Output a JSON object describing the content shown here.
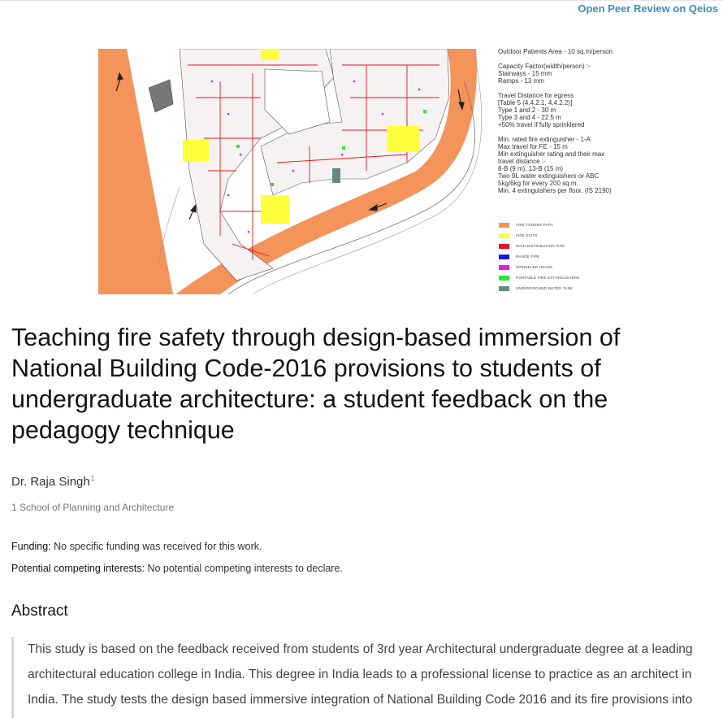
{
  "header": {
    "review_link": "Open Peer Review on Qeios"
  },
  "figure": {
    "notes": [
      {
        "lines": [
          "Outdoor Patients Area - 10 sq.m/person"
        ]
      },
      {
        "lines": [
          "Capacity Factor(width/person) :-",
          "Stairways - 15 mm",
          "Ramps - 13 mm"
        ]
      },
      {
        "lines": [
          "Travel Distance for egress",
          "[Table 5 (4.4.2.1, 4.4.2.2)]",
          "Type 1 and 2 - 30 m",
          "Type 3 and 4 - 22.5 m",
          "+50% travel if fully sprinklered"
        ]
      },
      {
        "lines": [
          "Min. rated fire extinguisher - 1-A",
          "Max travel for FE - 15 m",
          "Min extinguisher rating and their max",
          "travel distance :-",
          "8-B (9 m), 13-B (15 m)",
          "Two 9L water extinguishers or ABC",
          "5kg/6kg for every 200 sq.m.",
          "Min. 4 extinguishers per floor. (IS 2190)"
        ]
      }
    ],
    "legend": [
      {
        "label": "FIRE TENDER PATH",
        "color": "#f4935a"
      },
      {
        "label": "FIRE EXITS",
        "color": "#ffff3c"
      },
      {
        "label": "MAIN DISTRIBUTION PIPE",
        "color": "#e8141c"
      },
      {
        "label": "RANGE PIPE",
        "color": "#1a14e0"
      },
      {
        "label": "SPRINKLER HEADS",
        "color": "#f01ae0"
      },
      {
        "label": "PORTABLE FIRE EXTINGUISHERS",
        "color": "#2ae83a"
      },
      {
        "label": "UNDERGROUND WATER TANK",
        "color": "#5f8a88"
      }
    ]
  },
  "paper": {
    "title": "Teaching fire safety through design-based immersion of National Building Code-2016 provisions to students of undergraduate architecture: a student feedback on the pedagogy technique",
    "author": "Dr. Raja Singh",
    "author_sup": "1",
    "affiliation": "1 School of Planning and Architecture",
    "funding_label": "Funding:",
    "funding_text": "No specific funding was received for this work.",
    "interests_label": "Potential competing interests:",
    "interests_text": "No potential competing interests to declare.",
    "abstract_heading": "Abstract",
    "abstract_lines": [
      "This study is based on the feedback received from students of 3rd year Architectural undergraduate degree at a leading",
      "architectural education college in India. This degree in India leads to a professional license to practice as an architect in",
      "India. The study tests the design based immersive integration of National Building Code 2016 and its fire provisions into"
    ]
  }
}
